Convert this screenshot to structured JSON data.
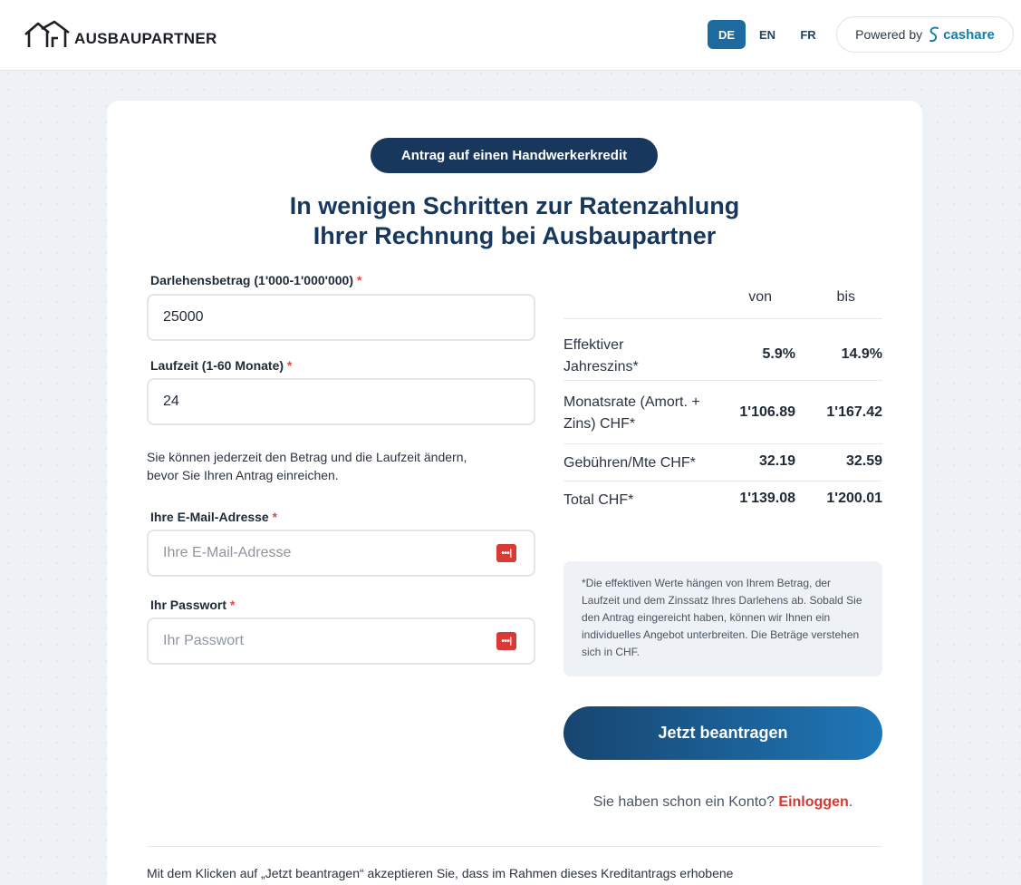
{
  "header": {
    "logo_text": "AUSBAUPARTNER",
    "languages": [
      "DE",
      "EN",
      "FR"
    ],
    "active_language": "DE",
    "powered_by": "Powered by",
    "powered_brand": "cashare"
  },
  "form": {
    "badge": "Antrag auf einen Handwerkerkredit",
    "headline_line1": "In wenigen Schritten zur Ratenzahlung",
    "headline_line2": "Ihrer Rechnung bei Ausbaupartner",
    "amount_label": "Darlehensbetrag (1'000-1'000'000)",
    "amount_value": "25000",
    "term_label": "Laufzeit (1-60 Monate)",
    "term_value": "24",
    "required_mark": "*",
    "hint": "Sie können jederzeit den Betrag und die Laufzeit ändern, bevor Sie Ihren Antrag einreichen.",
    "email_label": "Ihre E-Mail-Adresse",
    "email_placeholder": "Ihre E-Mail-Adresse",
    "password_label": "Ihr Passwort",
    "password_placeholder": "Ihr Passwort",
    "key_icon_text": "•••|"
  },
  "summary": {
    "col_from": "von",
    "col_to": "bis",
    "rows": [
      {
        "label": "Effektiver Jahreszins*",
        "from": "5.9%",
        "to": "14.9%"
      },
      {
        "label": "Monatsrate (Amort. + Zins) CHF*",
        "from": "1'106.89",
        "to": "1'167.42"
      },
      {
        "label": "Gebühren/Mte CHF*",
        "from": "32.19",
        "to": "32.59"
      },
      {
        "label": "Total CHF*",
        "from": "1'139.08",
        "to": "1'200.01"
      }
    ],
    "note": "*Die effektiven Werte hängen von Ihrem Betrag, der Laufzeit und dem Zinssatz Ihres Darlehens ab. Sobald Sie den Antrag eingereicht haben, können wir Ihnen ein individuelles Angebot unterbreiten. Die Beträge verstehen sich in CHF."
  },
  "actions": {
    "submit_label": "Jetzt beantragen",
    "login_prompt": "Sie haben schon ein Konto?",
    "login_link": "Einloggen",
    "login_suffix": "."
  },
  "footer": {
    "consent": "Mit dem Klicken auf „Jetzt beantragen“ akzeptieren Sie, dass im Rahmen dieses Kreditantrags erhobene"
  },
  "colors": {
    "primary": "#17385c",
    "accent": "#1d6aa0",
    "required": "#e04b45",
    "link": "#d8382f"
  }
}
